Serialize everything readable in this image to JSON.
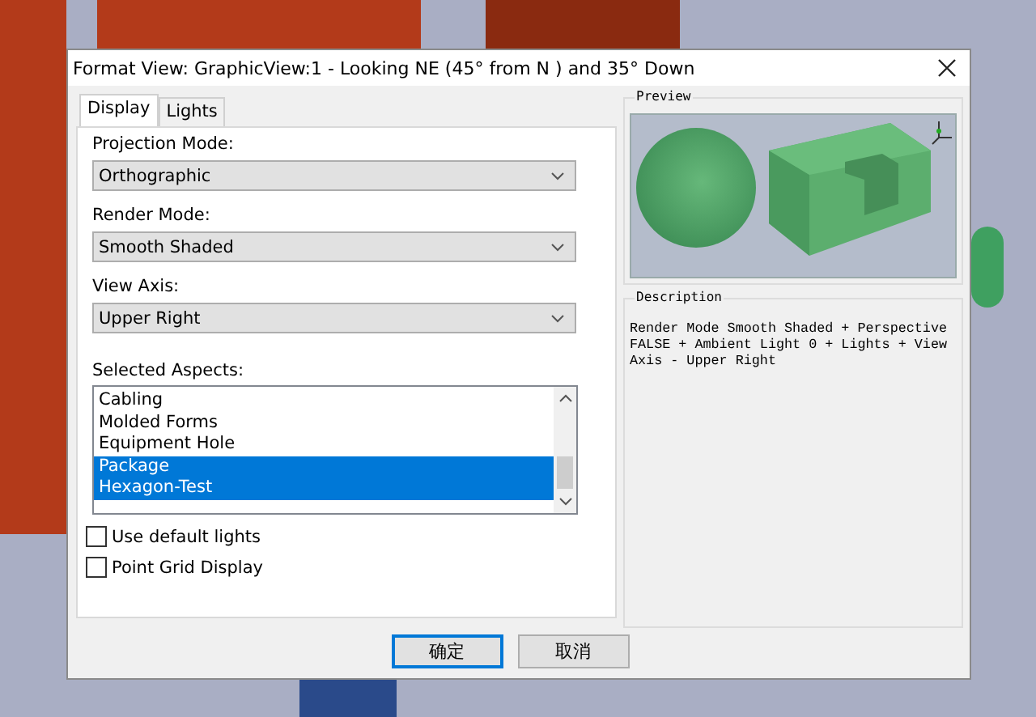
{
  "window": {
    "title": "Format View: GraphicView:1 - Looking NE (45° from N ) and 35° Down"
  },
  "tabs": [
    {
      "label": "Display",
      "selected": true
    },
    {
      "label": "Lights",
      "selected": false
    }
  ],
  "dropdowns": [
    {
      "label": "Projection Mode:",
      "value": "Orthographic"
    },
    {
      "label": "Render Mode:",
      "value": "Smooth Shaded"
    },
    {
      "label": "View Axis:",
      "value": "Upper Right"
    }
  ],
  "aspects": {
    "label": "Selected Aspects:",
    "items": [
      {
        "label": "Cabling",
        "selected": false
      },
      {
        "label": "Molded Forms",
        "selected": false
      },
      {
        "label": "Equipment Hole",
        "selected": false
      },
      {
        "label": "Package",
        "selected": true
      },
      {
        "label": "Hexagon-Test",
        "selected": true
      }
    ]
  },
  "checkboxes": [
    {
      "label": "Use default lights",
      "checked": false
    },
    {
      "label": "Point Grid Display",
      "checked": false
    }
  ],
  "preview": {
    "title": "Preview"
  },
  "description": {
    "title": "Description",
    "text": "Render Mode Smooth Shaded + Perspective FALSE + Ambient Light 0 + Lights + View Axis - Upper Right"
  },
  "buttons": [
    {
      "label": "确定",
      "default": true
    },
    {
      "label": "取消",
      "default": false
    }
  ]
}
